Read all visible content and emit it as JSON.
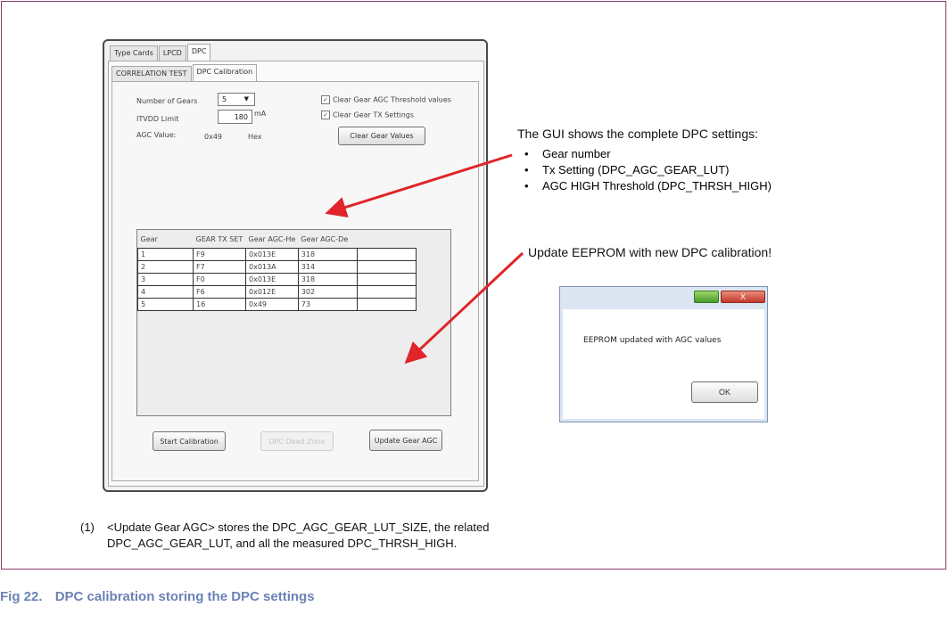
{
  "window": {
    "tabs": [
      "Type Cards",
      "LPCD",
      "DPC"
    ],
    "subtabs": [
      "CORRELATION TEST",
      "DPC Calibration"
    ],
    "number_of_gears_label": "Number of Gears",
    "number_of_gears_value": "5",
    "itvdo_label": "ITVDD Limit",
    "itvdo_value": "180",
    "itvdo_unit": "mA",
    "agc_label": "AGC Value:",
    "agc_value": "0x49",
    "agc_unit": "Hex",
    "clear_threshold_label": "Clear Gear AGC Threshold values",
    "clear_tx_label": "Clear Gear TX Settings",
    "clear_button": "Clear Gear Values",
    "table_headers": [
      "Gear",
      "GEAR TX SET",
      "Gear AGC-He",
      "Gear AGC-De"
    ],
    "table_rows": [
      [
        "1",
        "F9",
        "0x013E",
        "318"
      ],
      [
        "2",
        "F7",
        "0x013A",
        "314"
      ],
      [
        "3",
        "F0",
        "0x013E",
        "318"
      ],
      [
        "4",
        "F6",
        "0x012E",
        "302"
      ],
      [
        "5",
        "16",
        "0x49",
        "73"
      ]
    ],
    "start_button": "Start Calibration",
    "middle_button": "DPC Dead Zone",
    "update_button": "Update Gear AGC"
  },
  "annotation": {
    "heading": "The GUI shows the complete DPC settings:",
    "bullets": [
      "Gear number",
      "Tx Setting (DPC_AGC_GEAR_LUT)",
      "AGC HIGH Threshold (DPC_THRSH_HIGH)"
    ],
    "update_note": "Update EEPROM with new DPC calibration!"
  },
  "dialog": {
    "message": "EEPROM updated with AGC values",
    "ok": "OK",
    "close": "X"
  },
  "footnote": {
    "number": "(1)",
    "line1": "<Update Gear AGC> stores the DPC_AGC_GEAR_LUT_SIZE, the related",
    "line2": "DPC_AGC_GEAR_LUT, and all the measured DPC_THRSH_HIGH."
  },
  "caption": {
    "label": "Fig 22.",
    "text": "DPC calibration storing the DPC settings"
  },
  "colors": {
    "caption": "#6b82b5",
    "arrow": "#e0242a",
    "frame": "#8a3a66"
  }
}
